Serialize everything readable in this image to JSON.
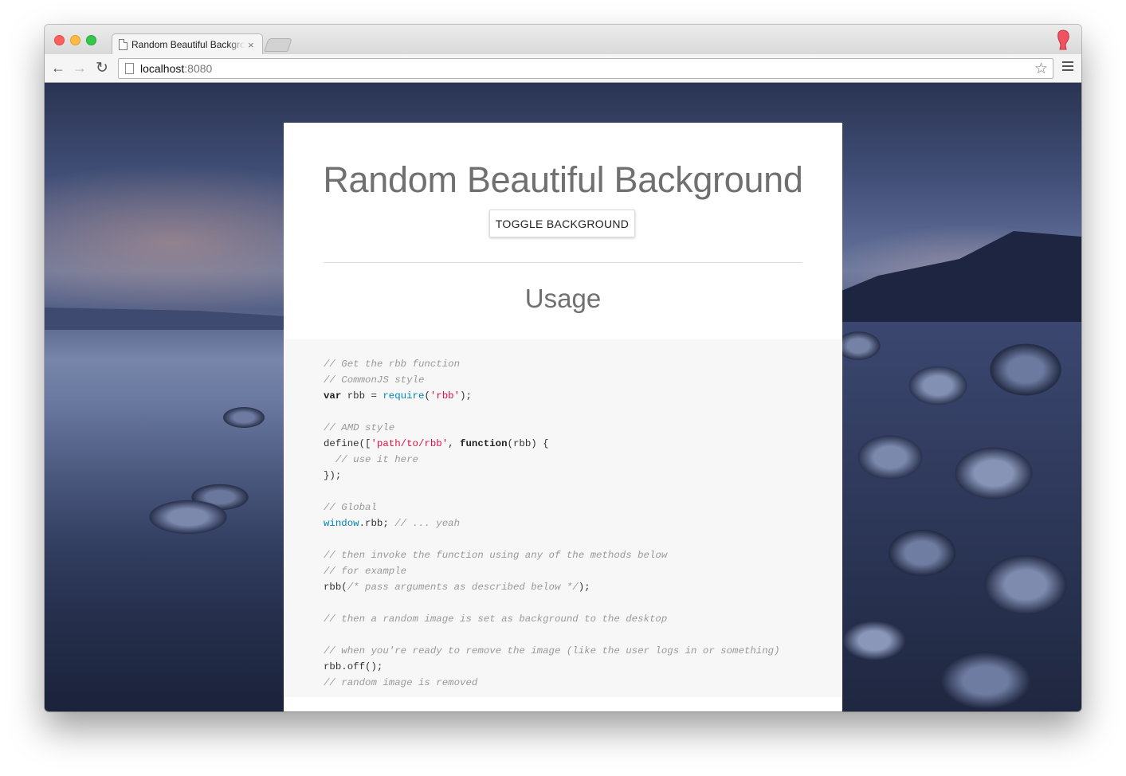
{
  "browser": {
    "tab_title": "Random Beautiful Backgro",
    "tab_close": "×",
    "url_host": "localhost",
    "url_port": ":8080",
    "star": "☆",
    "back": "←",
    "forward": "→",
    "reload": "↻"
  },
  "page": {
    "title": "Random Beautiful Background",
    "toggle_label": "TOGGLE BACKGROUND",
    "usage_heading": "Usage"
  },
  "code": {
    "l1": "// Get the rbb function",
    "l2": "// CommonJS style",
    "l3_kw": "var",
    "l3_mid": " rbb = ",
    "l3_fn": "require",
    "l3_open": "(",
    "l3_str": "'rbb'",
    "l3_end": ");",
    "l5": "// AMD style",
    "l6_a": "define([",
    "l6_str": "'path/to/rbb'",
    "l6_b": ", ",
    "l6_kw": "function",
    "l6_c": "(rbb) {",
    "l7": "  // use it here",
    "l8": "});",
    "l10": "// Global",
    "l11_obj": "window",
    "l11_mid": ".rbb; ",
    "l11_c": "// ... yeah",
    "l13": "// then invoke the function using any of the methods below",
    "l14": "// for example",
    "l15_a": "rbb(",
    "l15_c": "/* pass arguments as described below */",
    "l15_b": ");",
    "l17": "// then a random image is set as background to the desktop",
    "l19": "// when you're ready to remove the image (like the user logs in or something)",
    "l20": "rbb.off();",
    "l21": "// random image is removed"
  }
}
